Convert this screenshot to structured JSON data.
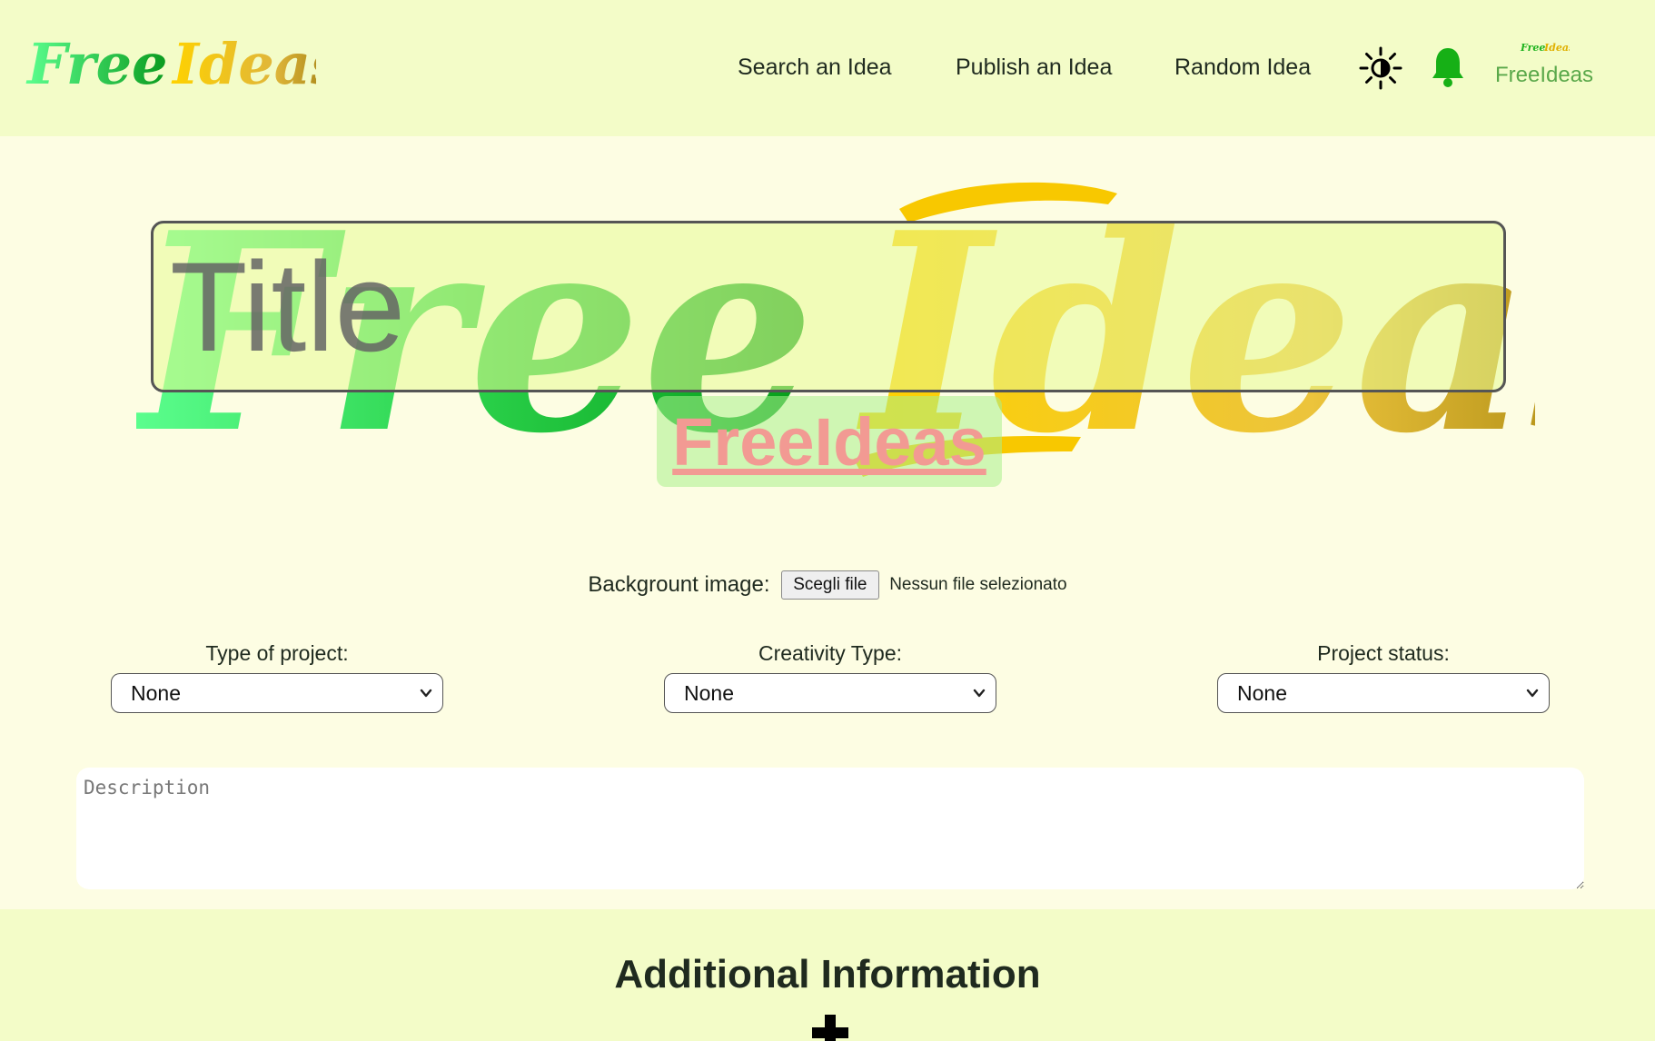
{
  "brand": {
    "logo_word1": "Free",
    "logo_word2": "Ideas"
  },
  "nav": {
    "search": "Search an Idea",
    "publish": "Publish an Idea",
    "random": "Random Idea",
    "theme_icon": "sun-icon",
    "notifications_icon": "bell-icon"
  },
  "profile": {
    "name": "FreeIdeas"
  },
  "editor": {
    "title_placeholder": "Title",
    "author": "FreeIdeas",
    "background_label": "Backgrount image:",
    "file_button": "Scegli file",
    "file_status": "Nessun file selezionato",
    "selects": [
      {
        "label": "Type of project:",
        "value": "None"
      },
      {
        "label": "Creativity Type:",
        "value": "None"
      },
      {
        "label": "Project status:",
        "value": "None"
      }
    ],
    "description_placeholder": "Description"
  },
  "additional": {
    "title": "Additional Information",
    "add_icon": "plus-icon"
  },
  "colors": {
    "header_bg": "#f3fcc8",
    "page_bg": "#fdfde3",
    "accent_green": "#1fb31f",
    "accent_yellow": "#f5c400",
    "author_pink": "#f29a93",
    "profile_green": "#5aa84a"
  }
}
